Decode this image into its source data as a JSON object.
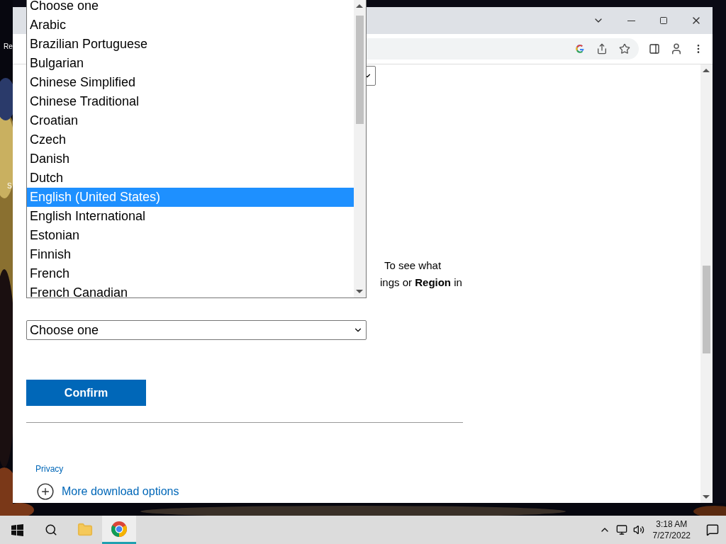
{
  "desktop": {
    "icon_labels": [
      "Re",
      "S"
    ]
  },
  "page": {
    "top_select": {
      "kind": "select"
    },
    "notice": {
      "line_1": "To see what",
      "line_2": "ings or **Region** in"
    },
    "language_select": {
      "value": "Choose one"
    },
    "confirm_button": "Confirm",
    "privacy_link": "Privacy",
    "more_download_options": "More download options"
  },
  "dropdown_list": {
    "items": [
      {
        "label": "Choose one",
        "selected": false
      },
      {
        "label": "Arabic",
        "selected": false
      },
      {
        "label": "Brazilian Portuguese",
        "selected": false
      },
      {
        "label": "Bulgarian",
        "selected": false
      },
      {
        "label": "Chinese Simplified",
        "selected": false
      },
      {
        "label": "Chinese Traditional",
        "selected": false
      },
      {
        "label": "Croatian",
        "selected": false
      },
      {
        "label": "Czech",
        "selected": false
      },
      {
        "label": "Danish",
        "selected": false
      },
      {
        "label": "Dutch",
        "selected": false
      },
      {
        "label": "English (United States)",
        "selected": true
      },
      {
        "label": "English International",
        "selected": false
      },
      {
        "label": "Estonian",
        "selected": false
      },
      {
        "label": "Finnish",
        "selected": false
      },
      {
        "label": "French",
        "selected": false
      },
      {
        "label": "French Canadian",
        "selected": false
      }
    ]
  },
  "taskbar": {
    "apps": [
      {
        "kind": "explorer",
        "selected": false
      },
      {
        "kind": "chrome",
        "selected": true
      }
    ],
    "time": "3:18 AM",
    "date": "7/27/2022"
  }
}
